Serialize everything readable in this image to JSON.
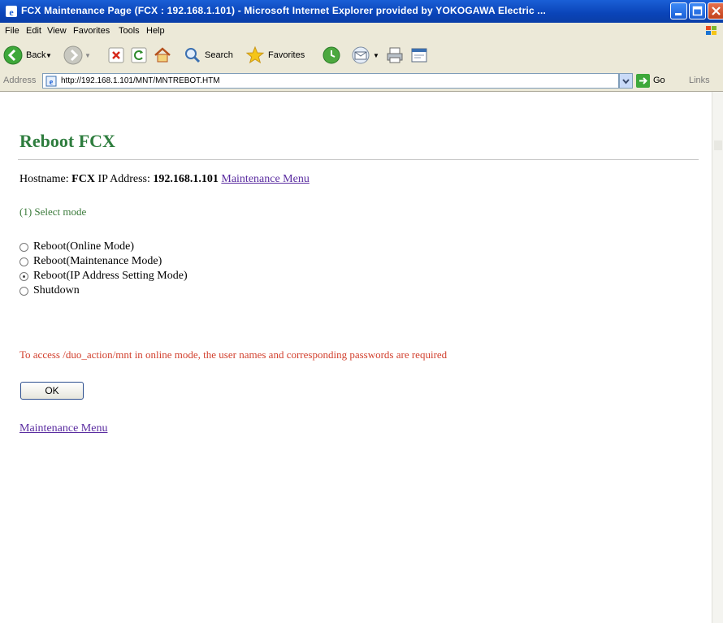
{
  "window": {
    "title": "FCX Maintenance Page (FCX : 192.168.1.101) - Microsoft Internet Explorer provided by YOKOGAWA Electric ..."
  },
  "menu": [
    "File",
    "Edit",
    "View",
    "Favorites",
    "Tools",
    "Help"
  ],
  "toolbar": {
    "back_label": "Back",
    "search_label": "Search",
    "favorites_label": "Favorites"
  },
  "addressbar": {
    "label": "Address",
    "url": "http://192.168.1.101/MNT/MNTREBOT.HTM",
    "go_label": "Go",
    "links_label": "Links"
  },
  "page": {
    "title": "Reboot FCX",
    "hostname_label": "Hostname:",
    "hostname_value": "FCX",
    "ip_label": "IP Address:",
    "ip_value": "192.168.1.101",
    "maintenance_link": "Maintenance Menu",
    "step_label": "(1) Select mode",
    "modes": [
      {
        "label": "Reboot(Online Mode)",
        "selected": false
      },
      {
        "label": "Reboot(Maintenance Mode)",
        "selected": false
      },
      {
        "label": "Reboot(IP Address Setting Mode)",
        "selected": true
      },
      {
        "label": "Shutdown",
        "selected": false
      }
    ],
    "warning": "To access /duo_action/mnt in online mode, the user names and corresponding passwords are required",
    "ok_label": "OK",
    "bottom_link": "Maintenance Menu"
  },
  "colors": {
    "title_green": "#2e7d3e",
    "warning_red": "#d2402e",
    "link_purple": "#5a2ca0",
    "titlebar_blue": "#0a44b8"
  }
}
